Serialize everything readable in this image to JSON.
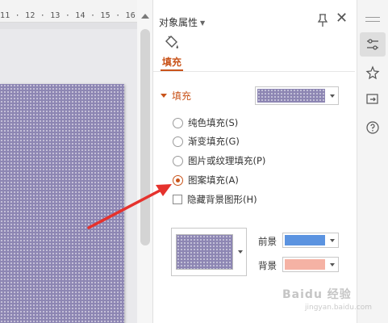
{
  "ruler": {
    "text": "11 · 12 · 13 · 14 · 15 · 16 ·"
  },
  "panel": {
    "title": "对象属性",
    "tab_label": "填充",
    "section_title": "填充",
    "options": [
      {
        "label": "纯色填充(S)",
        "selected": false
      },
      {
        "label": "渐变填充(G)",
        "selected": false
      },
      {
        "label": "图片或纹理填充(P)",
        "selected": false
      },
      {
        "label": "图案填充(A)",
        "selected": true
      }
    ],
    "hide_background_label": "隐藏背景图形(H)",
    "foreground_label": "前景",
    "background_label": "背景",
    "foreground_color": "#5b93e0",
    "background_color": "#f5b2a4",
    "pattern_color": "#8d86b3",
    "accent_color": "#c9541b"
  },
  "sidebar": {
    "icons": [
      "properties-icon",
      "star-pin-icon",
      "share-icon",
      "help-icon"
    ]
  },
  "watermark": {
    "text": "Baidu 经验",
    "sub": "jingyan.baidu.com"
  }
}
